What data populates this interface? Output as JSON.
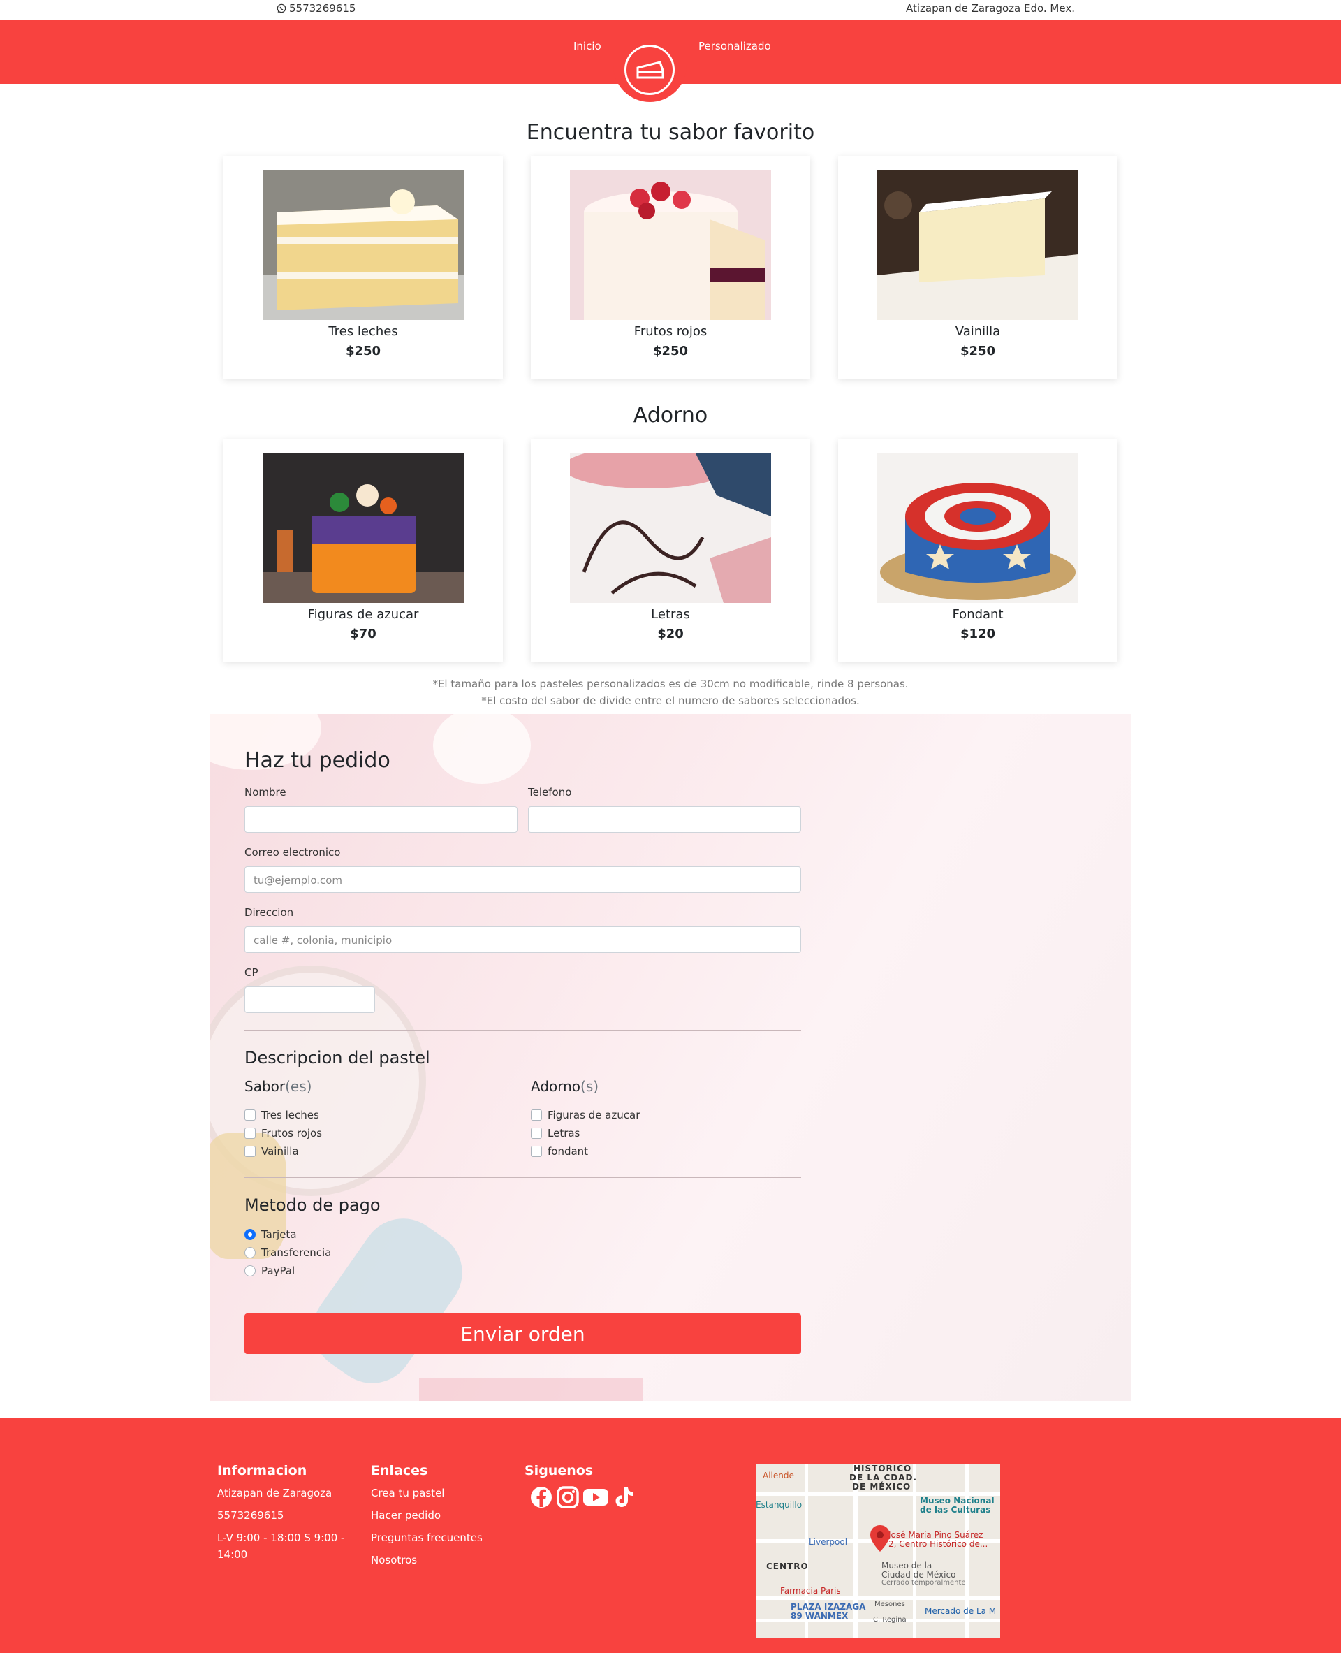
{
  "topbar": {
    "phone": "5573269615",
    "location": "Atizapan de Zaragoza Edo. Mex."
  },
  "nav": {
    "items": [
      {
        "label": "Inicio"
      },
      {
        "label": "Personalizado"
      }
    ]
  },
  "flavors": {
    "title": "Encuentra tu sabor favorito",
    "items": [
      {
        "name": "Tres leches",
        "price": "$250"
      },
      {
        "name": "Frutos rojos",
        "price": "$250"
      },
      {
        "name": "Vainilla",
        "price": "$250"
      }
    ]
  },
  "decorations": {
    "title": "Adorno",
    "items": [
      {
        "name": "Figuras de azucar",
        "price": "$70"
      },
      {
        "name": "Letras",
        "price": "$20"
      },
      {
        "name": "Fondant",
        "price": "$120"
      }
    ]
  },
  "notes": {
    "line1": "*El tamaño para los pasteles personalizados es de 30cm no modificable, rinde 8 personas.",
    "line2": "*El costo del sabor de divide entre el numero de sabores seleccionados."
  },
  "form": {
    "title": "Haz tu pedido",
    "name_label": "Nombre",
    "phone_label": "Telefono",
    "email_label": "Correo electronico",
    "email_placeholder": "tu@ejemplo.com",
    "address_label": "Direccion",
    "address_placeholder": "calle #, colonia, municipio",
    "cp_label": "CP",
    "desc_title": "Descripcion del pastel",
    "flavors_label": "Sabor",
    "flavors_suffix": "(es)",
    "flavor_options": [
      "Tres leches",
      "Frutos rojos",
      "Vainilla"
    ],
    "deco_label": "Adorno",
    "deco_suffix": "(s)",
    "deco_options": [
      "Figuras de azucar",
      "Letras",
      "fondant"
    ],
    "payment_title": "Metodo de pago",
    "payment_options": [
      "Tarjeta",
      "Transferencia",
      "PayPal"
    ],
    "payment_selected": "Tarjeta",
    "submit_label": "Enviar orden"
  },
  "footer": {
    "info": {
      "title": "Informacion",
      "lines": [
        "Atizapan de Zaragoza",
        "5573269615",
        "L-V 9:00 - 18:00 S 9:00 -",
        "14:00"
      ]
    },
    "links": {
      "title": "Enlaces",
      "items": [
        "Crea tu pastel",
        "Hacer pedido",
        "Preguntas frecuentes",
        "Nosotros"
      ]
    },
    "social": {
      "title": "Siguenos",
      "icons": [
        "facebook-icon",
        "instagram-icon",
        "youtube-icon",
        "tiktok-icon"
      ]
    },
    "map": {
      "labels": [
        "HISTÓRICO",
        "DE LA CDAD.",
        "DE MÉXICO",
        "Allende",
        "Estanquillo",
        "Museo Nacional",
        "de las Culturas",
        "José María Pino Suárez",
        "2, Centro Histórico de...",
        "Liverpool",
        "CENTRO",
        "Museo de la",
        "Ciudad de México",
        "Cerrado temporalmente",
        "Farmacia Paris",
        "PLAZA IZAZAGA",
        "89 WANMEX",
        "Mercado de La M",
        "Mesones",
        "C. Regina"
      ]
    }
  },
  "colors": {
    "brand": "#f8423f",
    "radio_on": "#0d6efd"
  }
}
